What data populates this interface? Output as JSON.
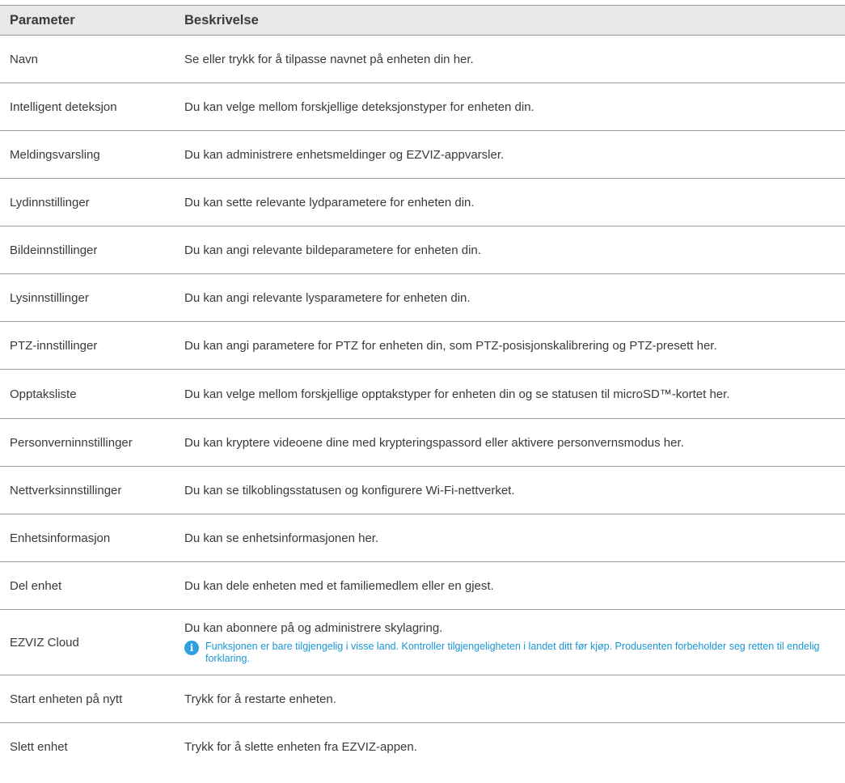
{
  "table": {
    "headers": [
      "Parameter",
      "Beskrivelse"
    ],
    "rows": [
      {
        "param": "Navn",
        "desc": "Se eller trykk for å tilpasse navnet på enheten din her."
      },
      {
        "param": "Intelligent deteksjon",
        "desc": "Du kan velge mellom forskjellige deteksjonstyper for enheten din."
      },
      {
        "param": "Meldingsvarsling",
        "desc": "Du kan administrere enhetsmeldinger og EZVIZ-appvarsler."
      },
      {
        "param": "Lydinnstillinger",
        "desc": "Du kan sette relevante lydparametere for enheten din."
      },
      {
        "param": "Bildeinnstillinger",
        "desc": "Du kan angi relevante bildeparametere for enheten din."
      },
      {
        "param": "Lysinnstillinger",
        "desc": "Du kan angi relevante lysparametere for enheten din."
      },
      {
        "param": "PTZ-innstillinger",
        "desc": "Du kan angi parametere for PTZ for enheten din, som PTZ-posisjonskalibrering og PTZ-presett her."
      },
      {
        "param": "Opptaksliste",
        "desc": "Du kan velge mellom forskjellige opptakstyper for enheten din og se statusen til microSD™-kortet her."
      },
      {
        "param": "Personverninnstillinger",
        "desc": "Du kan kryptere videoene dine med krypteringspassord eller aktivere personvernsmodus her."
      },
      {
        "param": "Nettverksinnstillinger",
        "desc": "Du kan se tilkoblingsstatusen og konfigurere Wi-Fi-nettverket."
      },
      {
        "param": "Enhetsinformasjon",
        "desc": "Du kan se enhetsinformasjonen her."
      },
      {
        "param": "Del enhet",
        "desc": "Du kan dele enheten med et familiemedlem eller en gjest."
      },
      {
        "param": "EZVIZ Cloud",
        "desc": "Du kan abonnere på og administrere skylagring.",
        "note": "Funksjonen er bare tilgjengelig i visse land. Kontroller tilgjengeligheten i landet ditt før kjøp. Produsenten forbeholder seg retten til endelig forklaring."
      },
      {
        "param": "Start enheten på nytt",
        "desc": "Trykk for å restarte enheten."
      },
      {
        "param": "Slett enhet",
        "desc": "Trykk for å slette enheten fra EZVIZ-appen."
      }
    ]
  },
  "icons": {
    "note_icon": "info-icon",
    "note_icon_color": "#2e9fe0"
  },
  "colors": {
    "header_bg": "#e8e8e8",
    "note_text": "#1a96d4",
    "rule": "#9a9a9a"
  }
}
